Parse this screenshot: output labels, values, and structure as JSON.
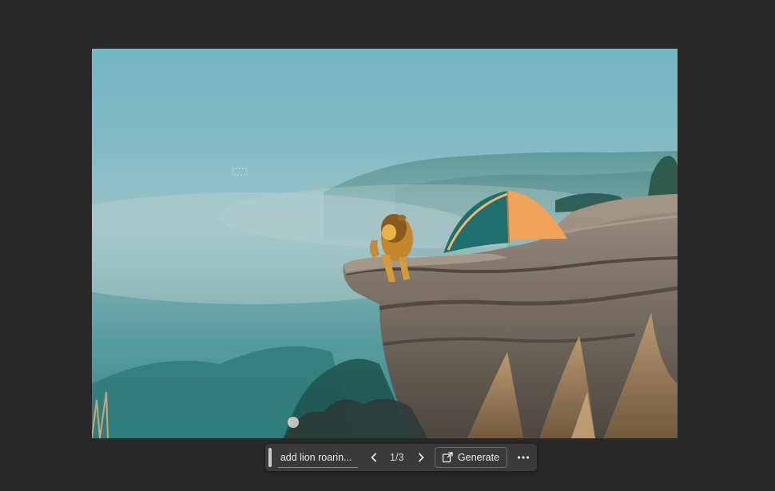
{
  "canvas": {
    "image_description_icon": "landscape-photo"
  },
  "taskbar": {
    "prompt_text": "add lion roarin...",
    "page_indicator": "1/3",
    "generate_label": "Generate",
    "icons": {
      "prev": "chevron-left-icon",
      "next": "chevron-right-icon",
      "generate": "generate-icon",
      "more": "more-options-icon"
    }
  },
  "colors": {
    "workspace_bg": "#282828",
    "taskbar_bg": "#3a3a3a",
    "text": "#e8e8e8"
  }
}
